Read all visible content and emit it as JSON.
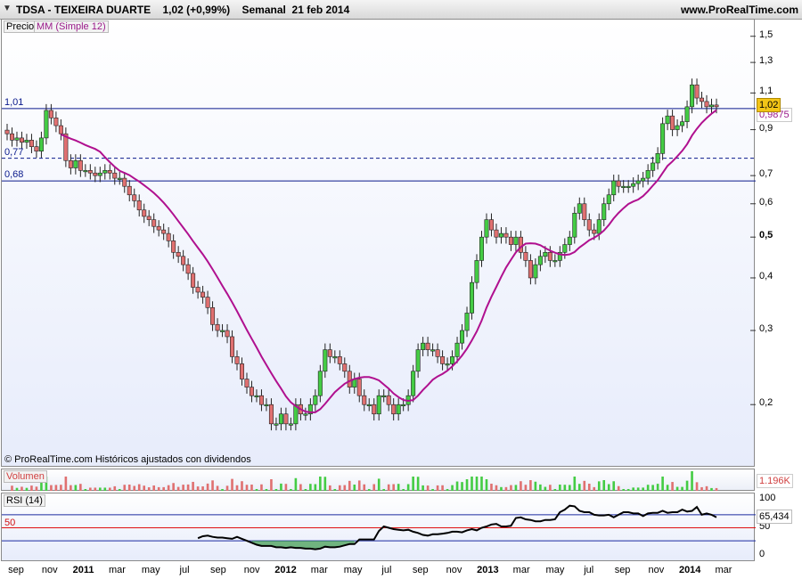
{
  "header": {
    "title": "TDSA - TEIXEIRA DUARTE    1,02 (+0,99%)    Semanal  21 feb 2014",
    "site": "www.ProRealTime.com"
  },
  "price_panel": {
    "label_precio": "Precio",
    "label_ma": "MM (Simple 12)",
    "copyright": "© ProRealTime.com  Históricos ajustados con dividendos",
    "hlines": [
      {
        "label": "1,01",
        "value": 1.01,
        "style": "solid"
      },
      {
        "label": "0,77",
        "value": 0.77,
        "style": "dashed"
      },
      {
        "label": "0,68",
        "value": 0.68,
        "style": "solid"
      }
    ],
    "y_ticks": [
      "1,5",
      "1,3",
      "1,1",
      "0,9",
      "0,7",
      "0,6",
      "0,5",
      "0,4",
      "0,3",
      "0,2"
    ],
    "last_price": "1,02",
    "ma_value": "0,9875"
  },
  "volume_panel": {
    "label": "Volumen",
    "value": "1.196K"
  },
  "rsi_panel": {
    "label": "RSI (14)",
    "level_label": "50",
    "y_ticks": [
      "100",
      "50",
      "0"
    ],
    "value": "65,434"
  },
  "x_axis": [
    "sep",
    "nov",
    "2011",
    "mar",
    "may",
    "jul",
    "sep",
    "nov",
    "2012",
    "mar",
    "may",
    "jul",
    "sep",
    "nov",
    "2013",
    "mar",
    "may",
    "jul",
    "sep",
    "nov",
    "2014",
    "mar"
  ],
  "colors": {
    "up": "#44cc44",
    "down": "#e07070",
    "ma": "#b0108f",
    "hline": "#0a1a8c",
    "rsi": "#000000",
    "oversold_fill": "#3a9a4a"
  },
  "chart_data": {
    "type": "candlestick",
    "title": "TDSA - TEIXEIRA DUARTE",
    "period": "weekly",
    "scale": "log",
    "ylim": [
      0.16,
      1.55
    ],
    "close_series": [
      0.88,
      0.85,
      0.86,
      0.84,
      0.85,
      0.82,
      0.8,
      0.86,
      1.0,
      0.96,
      0.92,
      0.88,
      0.76,
      0.73,
      0.76,
      0.72,
      0.72,
      0.71,
      0.7,
      0.71,
      0.72,
      0.71,
      0.69,
      0.69,
      0.66,
      0.63,
      0.61,
      0.58,
      0.56,
      0.55,
      0.53,
      0.52,
      0.51,
      0.49,
      0.46,
      0.45,
      0.43,
      0.41,
      0.38,
      0.37,
      0.36,
      0.34,
      0.31,
      0.3,
      0.3,
      0.29,
      0.26,
      0.25,
      0.23,
      0.22,
      0.21,
      0.21,
      0.2,
      0.2,
      0.18,
      0.18,
      0.19,
      0.18,
      0.18,
      0.2,
      0.19,
      0.19,
      0.2,
      0.21,
      0.24,
      0.27,
      0.26,
      0.26,
      0.25,
      0.24,
      0.22,
      0.23,
      0.21,
      0.2,
      0.2,
      0.19,
      0.21,
      0.21,
      0.2,
      0.19,
      0.2,
      0.2,
      0.21,
      0.24,
      0.27,
      0.28,
      0.27,
      0.27,
      0.26,
      0.25,
      0.25,
      0.26,
      0.28,
      0.3,
      0.33,
      0.39,
      0.44,
      0.5,
      0.55,
      0.52,
      0.5,
      0.51,
      0.5,
      0.48,
      0.5,
      0.46,
      0.44,
      0.4,
      0.43,
      0.45,
      0.46,
      0.44,
      0.44,
      0.46,
      0.48,
      0.5,
      0.57,
      0.6,
      0.55,
      0.52,
      0.51,
      0.55,
      0.6,
      0.63,
      0.68,
      0.66,
      0.66,
      0.66,
      0.67,
      0.68,
      0.69,
      0.72,
      0.75,
      0.79,
      0.93,
      0.97,
      0.9,
      0.92,
      0.94,
      1.02,
      1.15,
      1.07,
      1.05,
      1.02,
      1.03,
      1.02
    ],
    "ma_period": 12,
    "ma_last": 0.9875,
    "last_close": 1.02,
    "hlines": [
      1.01,
      0.77,
      0.68
    ],
    "rsi": {
      "period": 14,
      "ylim": [
        0,
        100
      ],
      "levels": [
        70,
        50,
        30
      ],
      "values": [
        34,
        37,
        38,
        36,
        35,
        35,
        34,
        33,
        36,
        33,
        30,
        27,
        24,
        22,
        22,
        22,
        20,
        20,
        19,
        20,
        19,
        19,
        18,
        18,
        17,
        18,
        21,
        20,
        20,
        21,
        23,
        25,
        25,
        32,
        32,
        32,
        32,
        45,
        52,
        50,
        48,
        47,
        46,
        47,
        44,
        42,
        39,
        38,
        40,
        40,
        41,
        42,
        44,
        44,
        43,
        46,
        48,
        46,
        50,
        52,
        55,
        56,
        52,
        52,
        53,
        65,
        66,
        63,
        62,
        60,
        60,
        62,
        62,
        63,
        74,
        78,
        84,
        83,
        76,
        74,
        74,
        70,
        69,
        69,
        70,
        66,
        70,
        74,
        74,
        72,
        72,
        68,
        72,
        73,
        73,
        76,
        73,
        74,
        74,
        78,
        75,
        76,
        82,
        70,
        72,
        70,
        66
      ],
      "last": 65.434
    },
    "x_ticks": [
      "sep",
      "nov",
      "2011",
      "mar",
      "may",
      "jul",
      "sep",
      "nov",
      "2012",
      "mar",
      "may",
      "jul",
      "sep",
      "nov",
      "2013",
      "mar",
      "may",
      "jul",
      "sep",
      "nov",
      "2014",
      "mar"
    ]
  }
}
